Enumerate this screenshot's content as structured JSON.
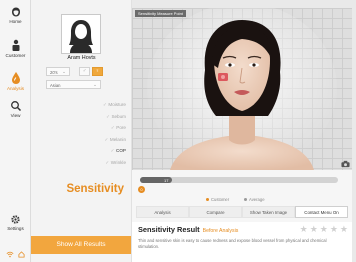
{
  "nav": {
    "items": [
      {
        "label": "Home",
        "icon": "face-icon"
      },
      {
        "label": "Customer",
        "icon": "person-icon"
      },
      {
        "label": "Analysis",
        "icon": "droplet-icon"
      },
      {
        "label": "View",
        "icon": "magnifier-icon"
      }
    ],
    "settings_label": "Settings"
  },
  "profile": {
    "name": "Aram Hovts",
    "age": "20's",
    "ethnicity": "Asian",
    "gender_options": [
      "♂",
      "♀"
    ],
    "selected_gender": "♀"
  },
  "metrics": [
    {
      "label": "Moisture",
      "highlighted": false
    },
    {
      "label": "Sebum",
      "highlighted": false
    },
    {
      "label": "Pore",
      "highlighted": false
    },
    {
      "label": "Melanin",
      "highlighted": false
    },
    {
      "label": "COP",
      "highlighted": true
    },
    {
      "label": "Wrinkle",
      "highlighted": false
    }
  ],
  "current_metric": "Sensitivity",
  "show_all_label": "Show All Results",
  "viewer": {
    "label": "Sensitivity Measure Point"
  },
  "slider": {
    "value_label": "17",
    "fraction": 0.16,
    "marker_label": "0"
  },
  "legend": {
    "customer": "Customer",
    "average": "Average",
    "customer_color": "#e68d22",
    "average_color": "#9a9a9a"
  },
  "tabs": [
    "Analysis",
    "Compare",
    "Show Taken Image",
    "Contact Menu On"
  ],
  "active_tab": 3,
  "result": {
    "title": "Sensitivity Result",
    "subtitle": "Before Analysis",
    "rating": 0,
    "max_rating": 5,
    "description": "Thin and sensitive skin is easy to cause redness and expose blood vessel from physical and chemical stimulation."
  },
  "colors": {
    "accent": "#e68d22",
    "button": "#f2a63e"
  }
}
